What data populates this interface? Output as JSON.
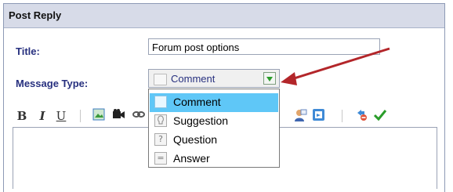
{
  "panel": {
    "title": "Post Reply"
  },
  "form": {
    "title_label": "Title:",
    "title_value": "Forum post options",
    "message_type_label": "Message Type:",
    "message_type_selected": "Comment"
  },
  "dropdown": {
    "options": [
      {
        "label": "Comment",
        "icon": "comment-icon",
        "selected": true
      },
      {
        "label": "Suggestion",
        "icon": "lightbulb-icon",
        "selected": false
      },
      {
        "label": "Question",
        "icon": "question-icon",
        "selected": false
      },
      {
        "label": "Answer",
        "icon": "answer-icon",
        "selected": false
      }
    ]
  },
  "toolbar": {
    "bold_label": "B",
    "italic_label": "I",
    "underline_label": "U",
    "icons": [
      "image-icon",
      "video-icon",
      "link-icon",
      "user-mention-icon",
      "quote-icon",
      "unlink-icon",
      "check-icon"
    ]
  },
  "colors": {
    "header_bg": "#d7dbe8",
    "label_text": "#27307f",
    "selected_item_bg": "#5fc7f7",
    "arrow": "#b3262a",
    "check": "#2a9d2a"
  }
}
